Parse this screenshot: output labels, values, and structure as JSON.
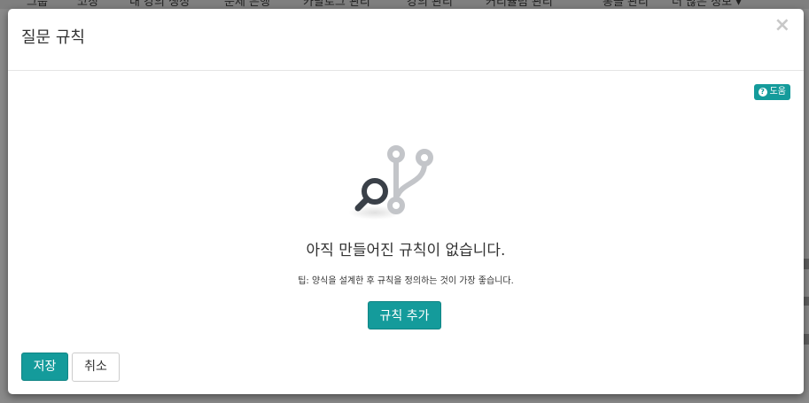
{
  "background_nav": {
    "items": [
      "그룹",
      "코칭",
      "내 강의 생성",
      "문제 은행",
      "카탈로그 관리",
      "강의 관리",
      "커리큘럼 관리",
      "통솔 관리",
      "더 많은 정보"
    ]
  },
  "modal": {
    "title": "질문 규칙",
    "close_icon": "×",
    "help_label": "도움",
    "empty_title": "아직 만들어진 규칙이 없습니다.",
    "empty_tip": "팁: 양식을 설계한 후 규칙을 정의하는 것이 가장 좋습니다.",
    "add_rule_label": "규칙 추가",
    "save_label": "저장",
    "cancel_label": "취소"
  },
  "colors": {
    "accent": "#149b9b",
    "overlay": "#8a8a8a",
    "illustration_dark": "#3a4048",
    "illustration_light": "#c3c5c9"
  },
  "icons": {
    "empty_state": "search-branch-icon",
    "help": "question-circle-icon",
    "close": "close-icon",
    "dropdown": "caret-down-icon"
  }
}
